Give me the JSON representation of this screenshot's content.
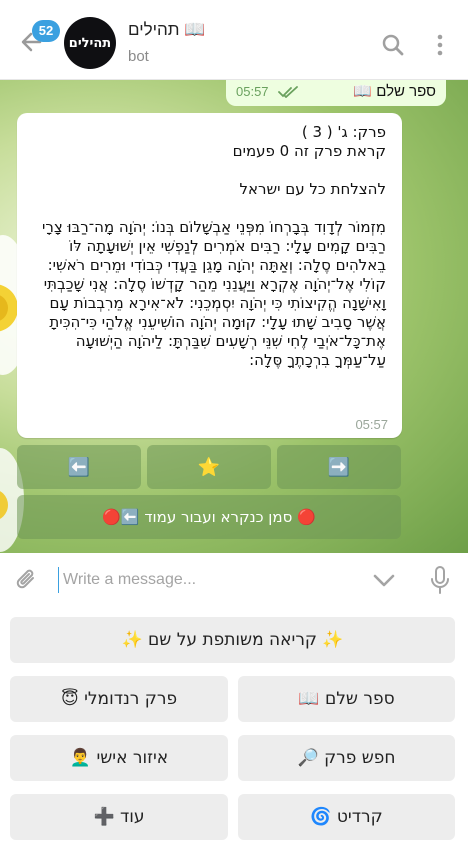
{
  "header": {
    "unread_count": "52",
    "avatar_label": "תהילים",
    "title": "תהילים 📖",
    "subtitle": "bot"
  },
  "outgoing": {
    "text": "ספר שלם 📖",
    "time": "05:57"
  },
  "incoming": {
    "text": "פרק: ג' ( 3 )\nקראת פרק זה 0 פעמים\n\nלהצלחת כל עם ישראל\n\nמִזְמוֹר לְדָוִד בְּבָרְחוֹ מִפְּנֵי אַבְשָׁלוֹם בְּנוֹ: יְהֹוָה מָה־רַבּוּ צָרָי רַבִּים קָמִים עָלָי: רַבִּים אֹמְרִים לְנַפְשִׁי אֵין יְשׁוּעָתָה לּוֹ בֵאלֹהִים סֶלָה: וְאַתָּה יְהֹוָה מָגֵן בַּעֲדִי כְּבוֹדִי וּמֵרִים רֹאשִׁי: קוֹלִי אֶל־יְהֹוָה אֶקְרָא וַיַּעֲנֵנִי מֵהַר קָדְשׁוֹ סֶלָה: אֲנִי שָׁכַבְתִּי וָאִישָׁנָה הֱקִיצוֹתִי כִּי יְהֹוָה יִסְמְכֵנִי: לֹא־אִירָא מֵרִבְבוֹת עָם אֲשֶׁר סָבִיב שָׁתוּ עָלָי: קוּמָה יְהֹוָה הוֹשִׁיעֵנִי אֱלֹהַי כִּי־הִכִּיתָ אֶת־כָּל־אֹיְבַי לֶחִי שִׁנֵּי רְשָׁעִים שִׁבַּרְתָּ: לַיהֹוָה הַיְשׁוּעָה עַל־עַמְּךָ בִרְכָתֶךָ סֶּלָה:",
    "time": "05:57"
  },
  "inline_keyboard": {
    "prev": "⬅️",
    "star": "⭐",
    "next": "➡️",
    "mark_read": "🔴 סמן כנקרא ועבור עמוד ⬅️🔴"
  },
  "input": {
    "placeholder": "Write a message..."
  },
  "reply_keyboard": {
    "shared_reading": "✨ קריאה משותפת על שם ✨",
    "full_book": "ספר שלם 📖",
    "random_chapter": "פרק רנדומלי 😇",
    "search_chapter": "חפש פרק 🔎",
    "personal_area": "איזור אישי 👨‍🦱",
    "credit": "קרדיט 🌀",
    "more": "עוד ➕"
  },
  "colors": {
    "accent": "#3aa0e0",
    "outgoing_bubble": "#eefee0",
    "check": "#6aa15e",
    "keyboard_button": "#ededed"
  }
}
